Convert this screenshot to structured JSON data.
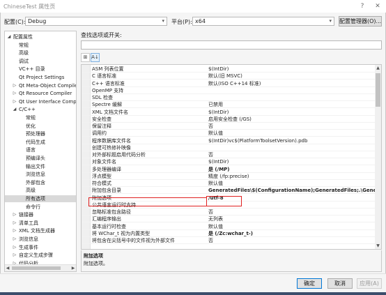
{
  "window": {
    "title": "ChineseTest 属性页",
    "help_glyph": "?",
    "close_glyph": "✕"
  },
  "config_bar": {
    "config_label": "配置(C):",
    "config_value": "Debug",
    "platform_label": "平台(P):",
    "platform_value": "x64",
    "manager_button": "配置管理器(O)..."
  },
  "tree": {
    "items": [
      {
        "label": "配置属性",
        "expander": "◢",
        "level": 0
      },
      {
        "label": "常规",
        "expander": "",
        "level": 1
      },
      {
        "label": "高级",
        "expander": "",
        "level": 1
      },
      {
        "label": "调试",
        "expander": "",
        "level": 1
      },
      {
        "label": "VC++ 目录",
        "expander": "",
        "level": 1
      },
      {
        "label": "Qt Project Settings",
        "expander": "",
        "level": 1
      },
      {
        "label": "Qt Meta-Object Compiler",
        "expander": "▷",
        "level": 1
      },
      {
        "label": "Qt Resource Compiler",
        "expander": "▷",
        "level": 1
      },
      {
        "label": "Qt User Interface Compiler",
        "expander": "▷",
        "level": 1
      },
      {
        "label": "C/C++",
        "expander": "◢",
        "level": 1
      },
      {
        "label": "常规",
        "expander": "",
        "level": 2
      },
      {
        "label": "优化",
        "expander": "",
        "level": 2
      },
      {
        "label": "预处理器",
        "expander": "",
        "level": 2
      },
      {
        "label": "代码生成",
        "expander": "",
        "level": 2
      },
      {
        "label": "语言",
        "expander": "",
        "level": 2
      },
      {
        "label": "预编译头",
        "expander": "",
        "level": 2
      },
      {
        "label": "输出文件",
        "expander": "",
        "level": 2
      },
      {
        "label": "浏览信息",
        "expander": "",
        "level": 2
      },
      {
        "label": "外部包含",
        "expander": "",
        "level": 2
      },
      {
        "label": "高级",
        "expander": "",
        "level": 2
      },
      {
        "label": "所有选项",
        "expander": "",
        "level": 2,
        "selected": true
      },
      {
        "label": "命令行",
        "expander": "",
        "level": 2
      },
      {
        "label": "链接器",
        "expander": "▷",
        "level": 1
      },
      {
        "label": "清单工具",
        "expander": "▷",
        "level": 1
      },
      {
        "label": "XML 文档生成器",
        "expander": "▷",
        "level": 1
      },
      {
        "label": "浏览信息",
        "expander": "▷",
        "level": 1
      },
      {
        "label": "生成事件",
        "expander": "▷",
        "level": 1
      },
      {
        "label": "自定义生成步骤",
        "expander": "▷",
        "level": 1
      },
      {
        "label": "代码分析",
        "expander": "▷",
        "level": 1
      }
    ]
  },
  "search": {
    "label": "查找选项或开关:",
    "value": ""
  },
  "toolbar": {
    "categorized_glyph": "⊞",
    "alpha_glyph": "A↓"
  },
  "properties": [
    {
      "name": "ASM 列表位置",
      "value": "$(IntDir)"
    },
    {
      "name": "C 语言标准",
      "value": "默认(旧 MSVC)"
    },
    {
      "name": "C++ 语言标准",
      "value": "默认(ISO C++14 标准)"
    },
    {
      "name": "OpenMP 支持",
      "value": ""
    },
    {
      "name": "SDL 检查",
      "value": ""
    },
    {
      "name": "Spectre 缓解",
      "value": "已禁用"
    },
    {
      "name": "XML 文档文件名",
      "value": "$(IntDir)"
    },
    {
      "name": "安全检查",
      "value": "启用安全检查 (/GS)"
    },
    {
      "name": "保留注释",
      "value": "否"
    },
    {
      "name": "调用约",
      "value": "默认值"
    },
    {
      "name": "程序数据库文件名",
      "value": "$(IntDir)vc$(PlatformToolsetVersion).pdb"
    },
    {
      "name": "创建可热修补映像",
      "value": ""
    },
    {
      "name": "对外部标题启用代码分析",
      "value": "否"
    },
    {
      "name": "对象文件名",
      "value": "$(IntDir)"
    },
    {
      "name": "多处理器编译",
      "value": "是 (/MP)",
      "bold": true
    },
    {
      "name": "浮点模型",
      "value": "精度 (/fp:precise)"
    },
    {
      "name": "符合模式",
      "value": "默认值"
    },
    {
      "name": "附加包含目录",
      "value": "GeneratedFiles\\$(ConfigurationName);GeneratedFiles;.\\GeneratedFile",
      "bold": true
    },
    {
      "name": "附加选项",
      "value": "/utf-8",
      "bold": true
    },
    {
      "name": "公共语言运行时支持",
      "value": ""
    },
    {
      "name": "忽略标准包含路径",
      "value": "否"
    },
    {
      "name": "汇编程序输出",
      "value": "无列表"
    },
    {
      "name": "基本运行时检查",
      "value": "默认值"
    },
    {
      "name": "将 WChar_t 视为内置类型",
      "value": "是 (/Zc:wchar_t-)",
      "bold": true
    },
    {
      "name": "将包含在尖括号中的文件视为外部文件",
      "value": "否"
    }
  ],
  "description": {
    "title": "附加选项",
    "body": "附加选项。"
  },
  "buttons": {
    "ok": "确定",
    "cancel": "取消",
    "apply": "应用(A)"
  },
  "colors": {
    "highlight_border": "#e02020",
    "accent": "#0078d7"
  }
}
